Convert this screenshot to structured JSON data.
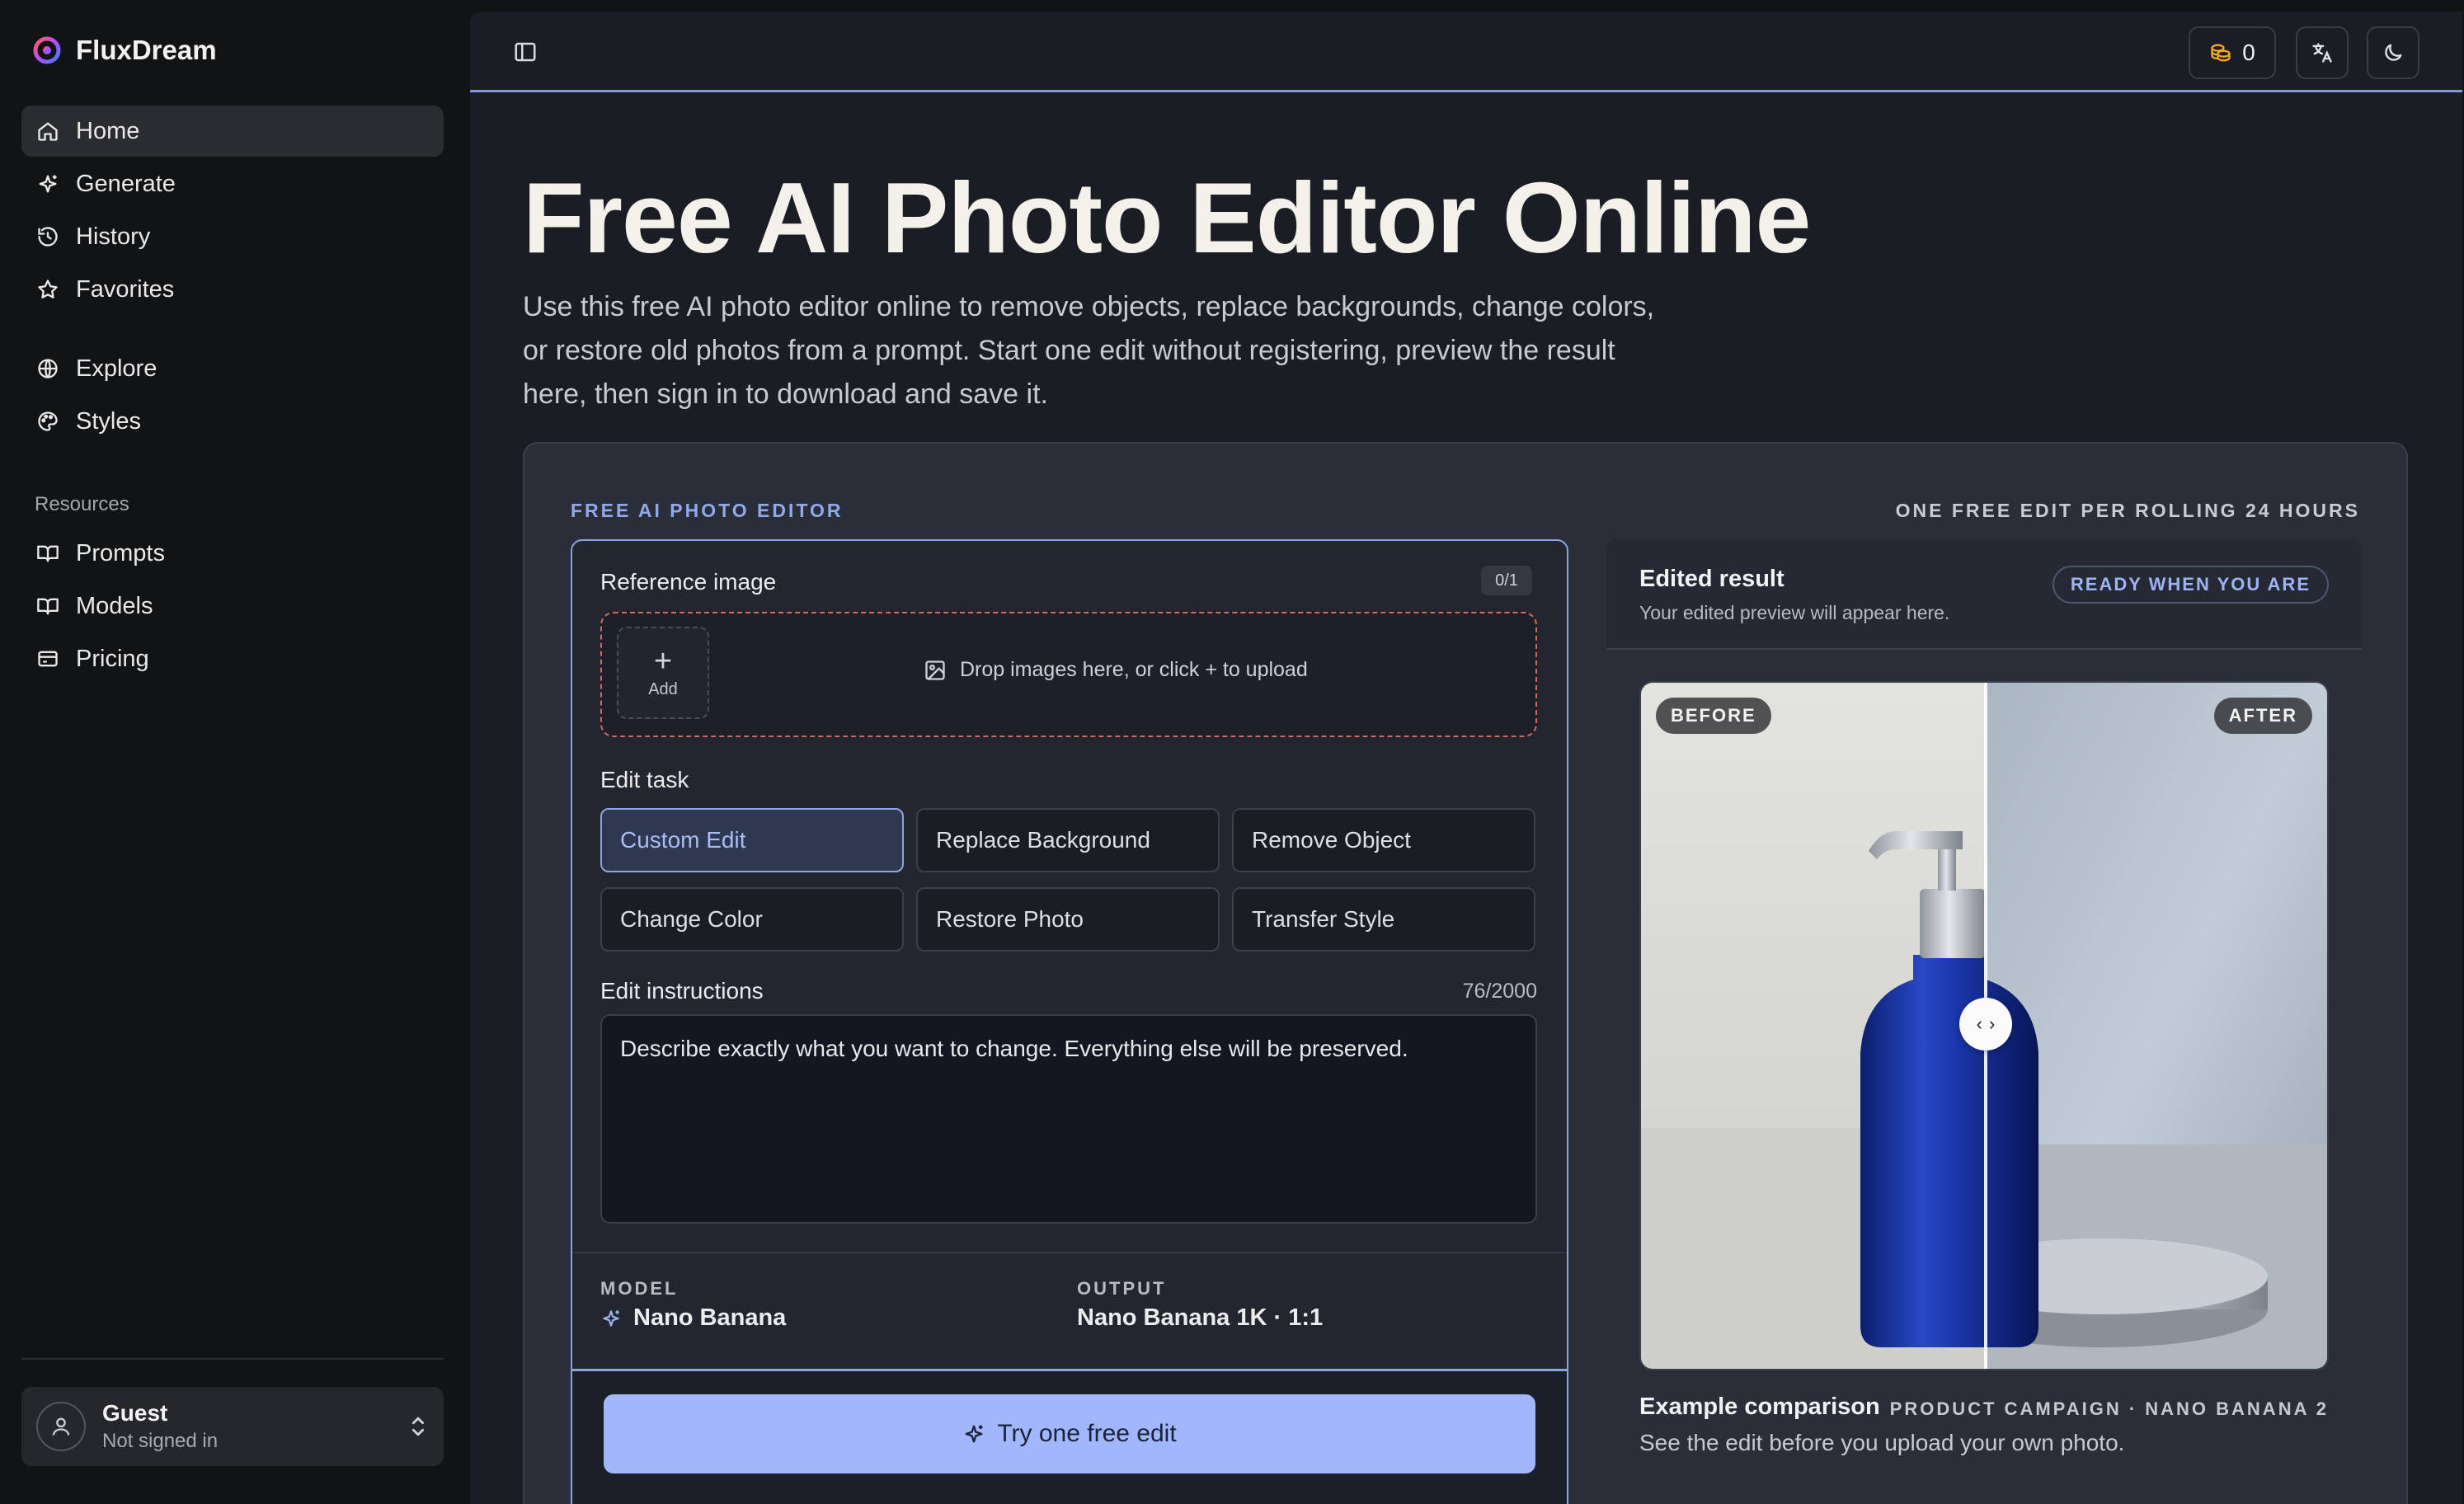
{
  "app": {
    "name": "FluxDream"
  },
  "sidebar": {
    "primary": [
      {
        "label": "Home",
        "icon": "home-icon",
        "active": true
      },
      {
        "label": "Generate",
        "icon": "sparkle-icon"
      },
      {
        "label": "History",
        "icon": "history-icon"
      },
      {
        "label": "Favorites",
        "icon": "star-icon"
      }
    ],
    "secondary": [
      {
        "label": "Explore",
        "icon": "globe-icon"
      },
      {
        "label": "Styles",
        "icon": "palette-icon"
      }
    ],
    "resources_label": "Resources",
    "resources": [
      {
        "label": "Prompts",
        "icon": "book-icon"
      },
      {
        "label": "Models",
        "icon": "book-icon"
      },
      {
        "label": "Pricing",
        "icon": "credit-card-icon"
      }
    ],
    "user": {
      "name": "Guest",
      "status": "Not signed in"
    }
  },
  "topbar": {
    "credits": "0"
  },
  "hero": {
    "title": "Free AI Photo Editor Online",
    "description": "Use this free AI photo editor online to remove objects, replace backgrounds, change colors, or restore old photos from a prompt. Start one edit without registering, preview the result here, then sign in to download and save it."
  },
  "editor": {
    "eyebrow_left": "FREE AI PHOTO EDITOR",
    "eyebrow_right": "ONE FREE EDIT PER ROLLING 24 HOURS",
    "reference": {
      "label": "Reference image",
      "count": "0/1",
      "add_label": "Add",
      "drop_text": "Drop images here, or click + to upload"
    },
    "task_label": "Edit task",
    "tasks": [
      "Custom Edit",
      "Replace Background",
      "Remove Object",
      "Change Color",
      "Restore Photo",
      "Transfer Style"
    ],
    "active_task": "Custom Edit",
    "instructions": {
      "label": "Edit instructions",
      "count": "76/2000",
      "placeholder": "Describe exactly what you want to change. Everything else will be preserved."
    },
    "model": {
      "label": "MODEL",
      "value": "Nano Banana"
    },
    "output": {
      "label": "OUTPUT",
      "value": "Nano Banana 1K · 1:1"
    },
    "submit_label": "Try one free edit"
  },
  "result": {
    "title": "Edited result",
    "subtitle": "Your edited preview will appear here.",
    "status": "READY WHEN YOU ARE",
    "before_label": "BEFORE",
    "after_label": "AFTER",
    "caption_title": "Example comparison",
    "caption_meta": "PRODUCT CAMPAIGN · NANO BANANA 2",
    "caption_sub": "See the edit before you upload your own photo."
  },
  "colors": {
    "accent": "#a2b7fb",
    "accent_border": "#8aa3e0",
    "dropzone_border": "#d1695e",
    "credit_icon": "#f5a623"
  }
}
